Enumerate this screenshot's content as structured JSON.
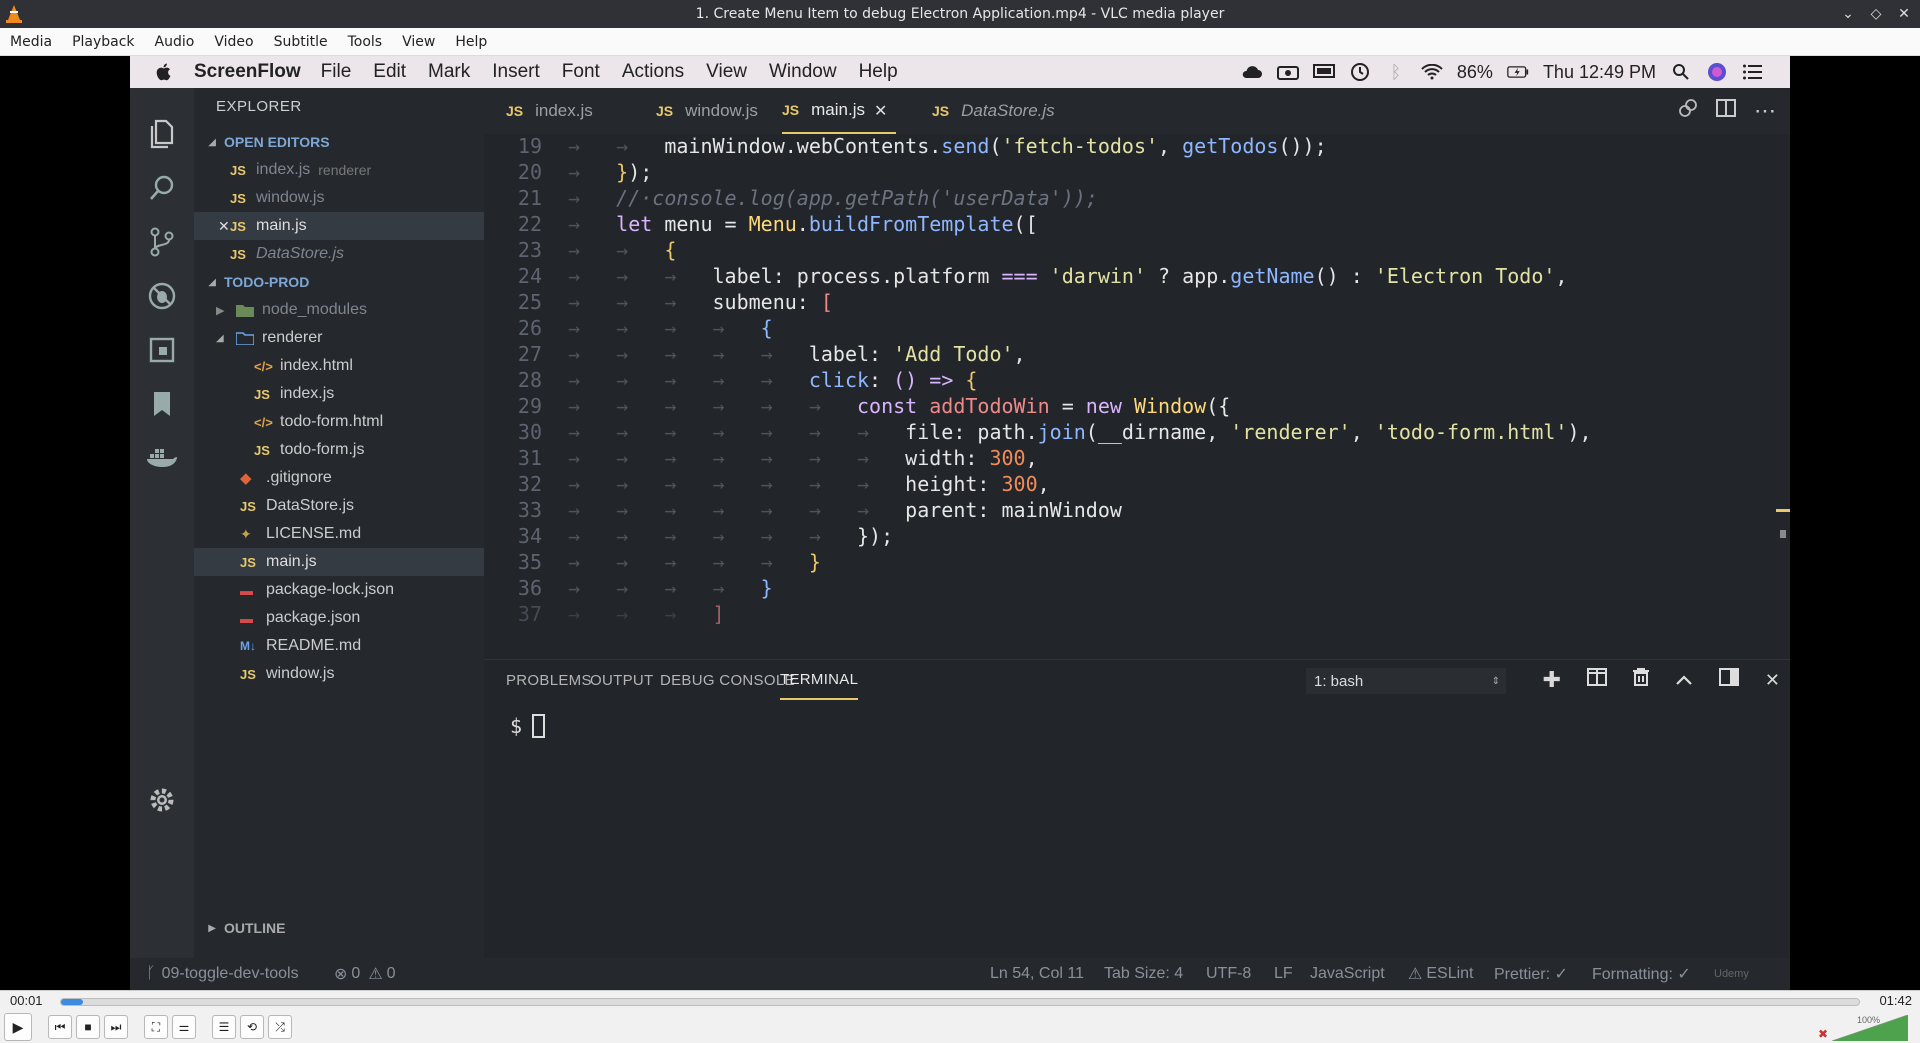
{
  "vlc": {
    "title": "1. Create Menu Item to debug Electron Application.mp4 - VLC media player",
    "window_controls": [
      "⌄",
      "◇",
      "✕"
    ],
    "menu": [
      "Media",
      "Playback",
      "Audio",
      "Video",
      "Subtitle",
      "Tools",
      "View",
      "Help"
    ],
    "time_elapsed": "00:01",
    "time_total": "01:42",
    "progress_fraction": 0.012,
    "volume_label": "100%",
    "volume_fraction": 1.0,
    "controls": {
      "play": "▶",
      "prev": "⏮",
      "stop": "■",
      "next": "⏭",
      "fullscreen": "⛶",
      "extended": "⚌",
      "playlist": "☰",
      "loop": "⟲",
      "random": "⤮"
    }
  },
  "mac": {
    "apple": "",
    "app_name": "ScreenFlow",
    "menu": [
      "File",
      "Edit",
      "Mark",
      "Insert",
      "Font",
      "Actions",
      "View",
      "Window",
      "Help"
    ],
    "battery": "86%",
    "clock": "Thu 12:49 PM"
  },
  "explorer": {
    "title": "EXPLORER",
    "open_editors_label": "OPEN EDITORS",
    "open_editors": [
      {
        "name": "index.js",
        "desc": "renderer"
      },
      {
        "name": "window.js",
        "desc": ""
      },
      {
        "name": "main.js",
        "desc": ""
      },
      {
        "name": "DataStore.js",
        "desc": ""
      }
    ],
    "project_label": "TODO-PROD",
    "tree": {
      "node_modules": "node_modules",
      "renderer": "renderer",
      "index_html": "index.html",
      "index_js": "index.js",
      "todo_form_html": "todo-form.html",
      "todo_form_js": "todo-form.js",
      "gitignore": ".gitignore",
      "datastore": "DataStore.js",
      "license": "LICENSE.md",
      "main": "main.js",
      "package_lock": "package-lock.json",
      "package": "package.json",
      "readme": "README.md",
      "window": "window.js"
    },
    "outline_label": "OUTLINE"
  },
  "tabs": [
    "index.js",
    "window.js",
    "main.js",
    "DataStore.js"
  ],
  "tab_badge": "JS",
  "editor": {
    "line_numbers": [
      "19",
      "20",
      "21",
      "22",
      "23",
      "24",
      "25",
      "26",
      "27",
      "28",
      "29",
      "30",
      "31",
      "32",
      "33",
      "34",
      "35",
      "36",
      "37"
    ]
  },
  "panel": {
    "tabs": [
      "PROBLEMS",
      "OUTPUT",
      "DEBUG CONSOLE",
      "TERMINAL"
    ],
    "shell_select": "1: bash",
    "prompt": "$"
  },
  "status": {
    "branch": "09-toggle-dev-tools",
    "errors": "0",
    "warnings": "0",
    "position": "Ln 54, Col 11",
    "tab_size": "Tab Size: 4",
    "encoding": "UTF-8",
    "eol": "LF",
    "language": "JavaScript",
    "eslint": "ESLint",
    "prettier": "Prettier: ✓",
    "formatting": "Formatting: ✓",
    "watermark": "Udemy"
  },
  "colors": {
    "editor_bg": "#222529",
    "accent": "#e8c86a",
    "vlc_progress": "#3b8be0"
  }
}
